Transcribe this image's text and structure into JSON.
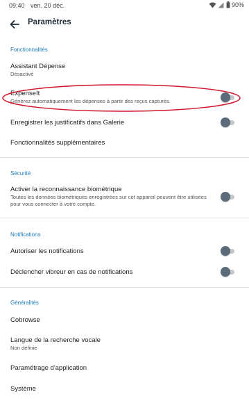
{
  "status_bar": {
    "time": "09:40",
    "date": "ven. 20 déc.",
    "battery": "90%"
  },
  "app_bar": {
    "title": "Paramètres"
  },
  "sections": {
    "features": {
      "header": "Fonctionnalités",
      "assistant": {
        "title": "Assistant Dépense",
        "subtitle": "Désactivé"
      },
      "expenseit": {
        "title": "ExpenseIt",
        "subtitle": "Générez automatiquement les dépenses à partir des reçus capturés.",
        "enabled": false
      },
      "save_receipts": {
        "title": "Enregistrer les justificatifs dans Galerie",
        "enabled": false
      },
      "more_features": {
        "title": "Fonctionnalités supplémentaires"
      }
    },
    "security": {
      "header": "Sécurité",
      "biometric": {
        "title": "Activer la reconnaissance biométrique",
        "subtitle": "Toutes les données biométriques enregistrées sur cet appareil peuvent être utilisées pour vous connecter à votre compte.",
        "enabled": false
      }
    },
    "notifications": {
      "header": "Notifications",
      "allow": {
        "title": "Autoriser les notifications",
        "enabled": false
      },
      "vibrate": {
        "title": "Déclencher vibreur en cas de notifications",
        "enabled": false
      }
    },
    "general": {
      "header": "Généralités",
      "cobrowse": {
        "title": "Cobrowse"
      },
      "voice_language": {
        "title": "Langue de la recherche vocale",
        "subtitle": "Non définie"
      },
      "app_settings": {
        "title": "Paramétrage d'application"
      },
      "system": {
        "title": "Système"
      }
    }
  },
  "colors": {
    "accent": "#1f7ab8",
    "highlight": "#d0152a",
    "toggle_thumb": "#5b6b7a"
  }
}
